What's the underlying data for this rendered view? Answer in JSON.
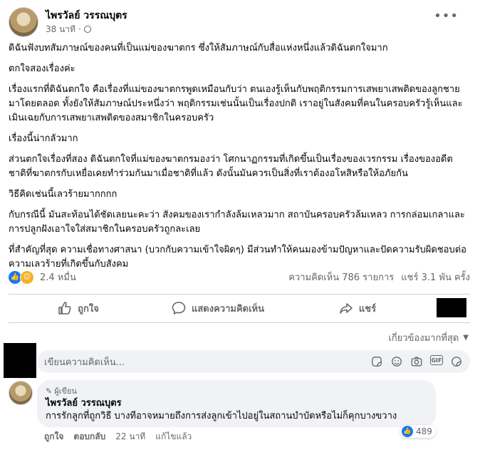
{
  "post": {
    "author": "ไพรวัลย์ วรรณบุตร",
    "time": "38 นาที",
    "paragraphs": [
      "ดิฉันฟังบทสัมภาษณ์ของคนที่เป็นแม่ของฆาตกร ซึ่งให้สัมภาษณ์กับสื่อแห่งหนึ่งแล้วดิฉันตกใจมาก",
      "ตกใจสองเรื่องค่ะ",
      "เรื่องแรกที่ดิฉันตกใจ คือเรื่องที่แม่ของฆาตกรพูดเหมือนกับว่า ตนเองรู้เห็นกับพฤติกรรมการเสพยาเสพติดของลูกชายมาโดยตลอด ทั้งยังให้สัมภาษณ์ประหนึ่งว่า พฤติกรรมเช่นนั้นเป็นเรื่องปกติ เราอยู่ในสังคมที่คนในครอบครัวรู้เห็นและเมินเฉยกับการเสพยาเสพติดของสมาชิกในครอบครัว",
      "เรื่องนี้น่ากลัวมาก",
      "ส่วนตกใจเรื่องที่สอง ดิฉันตกใจที่แม่ของฆาตกรมองว่า โศกนาฏกรรมที่เกิดขึ้นเป็นเรื่องของเวรกรรม เรื่องของอดีตชาติที่ฆาตกรกับเหยื่อเคยทำร่วมกันมาเมื่อชาติที่แล้ว ดังนั้นมันควรเป็นสิ่งที่เราต้องอโหสิหรือให้อภัยกัน",
      "วิธีคิดเช่นนี้เลวร้ายมากกกก",
      "กับกรณีนี้ มันสะท้อนได้ชัดเลยนะคะว่า สังคมของเรากำลังล้มเหลวมาก สถาบันครอบครัวล้มเหลว การกล่อมเกลาและการปลูกฝังเอาใจใส่สมาชิกในครอบครัวถูกละเลย",
      "ที่สำคัญที่สุด ความเชื่อทางศาสนา (บวกกับความเข้าใจผิดๆ) มีส่วนทำให้คนมองข้ามปัญหาและปัดความรับผิดชอบต่อความเลวร้ายที่เกิดขึ้นกับสังคม"
    ]
  },
  "stats": {
    "reactions": "2.4 หมื่น",
    "comments": "ความคิดเห็น 786 รายการ",
    "shares": "แชร์ 3.1 พัน ครั้ง"
  },
  "actions": {
    "like": "ถูกใจ",
    "comment": "แสดงความคิดเห็น",
    "share": "แชร์"
  },
  "sort": "เกี่ยวข้องมากที่สุด",
  "comment_input": {
    "placeholder": "เขียนความคิดเห็น..."
  },
  "comment": {
    "badge": "ผู้เขียน",
    "author": "ไพรวัลย์ วรรณบุตร",
    "text": "การรักลูกที่ถูกวิธี บางทีอาจหมายถึงการส่งลูกเข้าไปอยู่ในสถานบำบัดหรือไม่ก็คุกบางขวาง",
    "reactions": "489",
    "like": "ถูกใจ",
    "reply": "ตอบกลับ",
    "time": "22 นาที",
    "edit": "แก้ไขแล้ว"
  },
  "icons": {
    "globe": "globe-icon",
    "more": "more-options-icon",
    "like": "thumbs-up-icon",
    "comment": "comment-bubble-icon",
    "share": "share-arrow-icon",
    "sad": "sad-reaction-icon",
    "camera": "camera-icon",
    "emoji": "emoji-icon",
    "gif": "gif-icon",
    "sticker": "sticker-icon",
    "pen": "pen-icon"
  }
}
